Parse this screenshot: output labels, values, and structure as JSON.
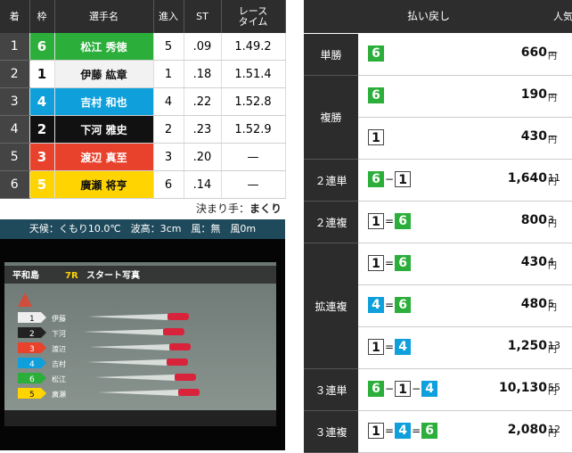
{
  "table": {
    "headers": [
      "着",
      "枠",
      "選手名",
      "進入",
      "ST",
      "レース\nタイム"
    ],
    "header_rank": "着",
    "header_lane": "枠",
    "header_name": "選手名",
    "header_entry": "進入",
    "header_st": "ST",
    "header_time_1": "レース",
    "header_time_2": "タイム",
    "rows": [
      {
        "rank": "1",
        "lane": "6",
        "name": "松江 秀徳",
        "entry": "5",
        "st": ".09",
        "time": "1.49.2"
      },
      {
        "rank": "2",
        "lane": "1",
        "name": "伊藤 紘章",
        "entry": "1",
        "st": ".18",
        "time": "1.51.4"
      },
      {
        "rank": "3",
        "lane": "4",
        "name": "吉村 和也",
        "entry": "4",
        "st": ".22",
        "time": "1.52.8"
      },
      {
        "rank": "4",
        "lane": "2",
        "name": "下河 雅史",
        "entry": "2",
        "st": ".23",
        "time": "1.52.9"
      },
      {
        "rank": "5",
        "lane": "3",
        "name": "渡辺 真至",
        "entry": "3",
        "st": ".20",
        "time": "—"
      },
      {
        "rank": "6",
        "lane": "5",
        "name": "廣瀬 将亨",
        "entry": "6",
        "st": ".14",
        "time": "—"
      }
    ]
  },
  "kimarite": {
    "label": "決まり手：",
    "value": "まくり"
  },
  "weather": "天候：くもり10.0℃　波高：3cm　風：無　風0m",
  "photo": {
    "venue": "平和島",
    "race": "7R",
    "caption": "スタート写真",
    "boats": [
      {
        "lane": "1",
        "name": "伊藤"
      },
      {
        "lane": "2",
        "name": "下河"
      },
      {
        "lane": "3",
        "name": "渡辺"
      },
      {
        "lane": "4",
        "name": "吉村"
      },
      {
        "lane": "6",
        "name": "松江"
      },
      {
        "lane": "5",
        "name": "廣瀬"
      }
    ]
  },
  "payout": {
    "header": "払い戻し",
    "header_pop": "人気",
    "yen": "円",
    "bets": [
      {
        "type": "単勝",
        "combo": [
          "6"
        ],
        "sep": [],
        "amount": "660",
        "pop": "—"
      },
      {
        "type": "複勝",
        "combo": [
          "6"
        ],
        "sep": [],
        "amount": "190",
        "pop": "—"
      },
      {
        "type": "",
        "combo": [
          "1"
        ],
        "sep": [],
        "amount": "430",
        "pop": "—"
      },
      {
        "type": "２連単",
        "combo": [
          "6",
          "1"
        ],
        "sep": [
          "−"
        ],
        "amount": "1,640",
        "pop": "11"
      },
      {
        "type": "２連複",
        "combo": [
          "1",
          "6"
        ],
        "sep": [
          "="
        ],
        "amount": "800",
        "pop": "3"
      },
      {
        "type": "拡連複",
        "combo": [
          "1",
          "6"
        ],
        "sep": [
          "="
        ],
        "amount": "430",
        "pop": "4"
      },
      {
        "type": "",
        "combo": [
          "4",
          "6"
        ],
        "sep": [
          "="
        ],
        "amount": "480",
        "pop": "5"
      },
      {
        "type": "",
        "combo": [
          "1",
          "4"
        ],
        "sep": [
          "="
        ],
        "amount": "1,250",
        "pop": "13"
      },
      {
        "type": "３連単",
        "combo": [
          "6",
          "1",
          "4"
        ],
        "sep": [
          "−",
          "−"
        ],
        "amount": "10,130",
        "pop": "55"
      },
      {
        "type": "３連複",
        "combo": [
          "1",
          "4",
          "6"
        ],
        "sep": [
          "=",
          "="
        ],
        "amount": "2,080",
        "pop": "12"
      }
    ]
  },
  "colors": {
    "lane1": "#ffffff",
    "lane2": "#111111",
    "lane3": "#e8412c",
    "lane4": "#0fa0dc",
    "lane5": "#ffd400",
    "lane6": "#2bae3a",
    "header_bg": "#2d2d2d"
  }
}
